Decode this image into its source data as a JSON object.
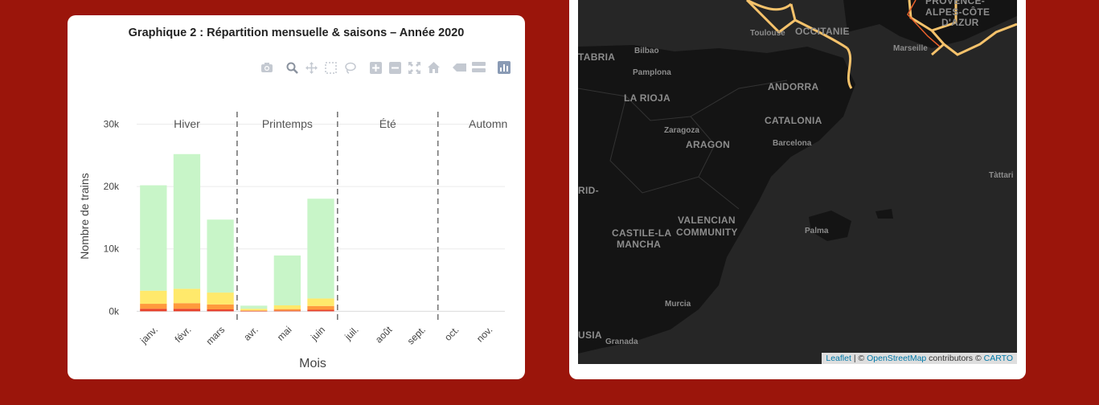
{
  "chart_card": {
    "title": "Graphique 2 : Répartition mensuelle & saisons – Année 2020",
    "modebar": [
      "camera-icon",
      "zoom-icon",
      "pan-icon",
      "box-select-icon",
      "lasso-icon",
      "zoom-in-icon",
      "zoom-out-icon",
      "autoscale-icon",
      "reset-axes-icon",
      "spike-lines-icon",
      "compare-data-icon",
      "plotly-logo-icon"
    ]
  },
  "chart_data": {
    "type": "bar",
    "stacked": true,
    "categories": [
      "janv.",
      "févr.",
      "mars",
      "avr.",
      "mai",
      "juin",
      "juil.",
      "août",
      "sept.",
      "oct.",
      "nov."
    ],
    "series": [
      {
        "color": "#e8412b",
        "values": [
          400,
          400,
          300,
          50,
          100,
          250,
          0,
          0,
          0,
          0,
          0
        ]
      },
      {
        "color": "#ff9a3c",
        "values": [
          800,
          900,
          800,
          100,
          250,
          600,
          0,
          0,
          0,
          0,
          0
        ]
      },
      {
        "color": "#ffe96b",
        "values": [
          2100,
          2300,
          1900,
          250,
          600,
          1200,
          0,
          0,
          0,
          0,
          0
        ]
      },
      {
        "color": "#c8f5c8",
        "values": [
          16900,
          21600,
          11700,
          500,
          8000,
          16000,
          0,
          0,
          0,
          0,
          0
        ]
      }
    ],
    "xlabel": "Mois",
    "ylabel": "Nombre de trains",
    "yticks": [
      0,
      10000,
      20000,
      30000
    ],
    "ytick_labels": [
      "0k",
      "10k",
      "20k",
      "30k"
    ],
    "ylim": [
      -1500,
      32000
    ],
    "grid": true,
    "season_labels": [
      "Hiver",
      "Printemps",
      "Été",
      "Automn"
    ]
  },
  "map": {
    "regions": [
      "OCCITANIE",
      "PROVENCE-",
      "ALPES-CÔTE",
      "D'AZUR",
      "ANDORRA",
      "LA RIOJA",
      "ARAGON",
      "CATALONIA",
      "VALENCIAN",
      "COMMUNITY",
      "CASTILE-LA",
      "MANCHA",
      "TABRIA",
      "RID-",
      "USIA"
    ],
    "cities": [
      "Toulouse",
      "Bilbao",
      "Pamplona",
      "Zaragoza",
      "Barcelona",
      "Marseille",
      "Palma",
      "Murcia",
      "Granada",
      "Tàttari"
    ],
    "attribution": {
      "leaflet": "Leaflet",
      "sep1": " | © ",
      "osm": "OpenStreetMap",
      "mid": " contributors © ",
      "carto": "CARTO"
    }
  }
}
